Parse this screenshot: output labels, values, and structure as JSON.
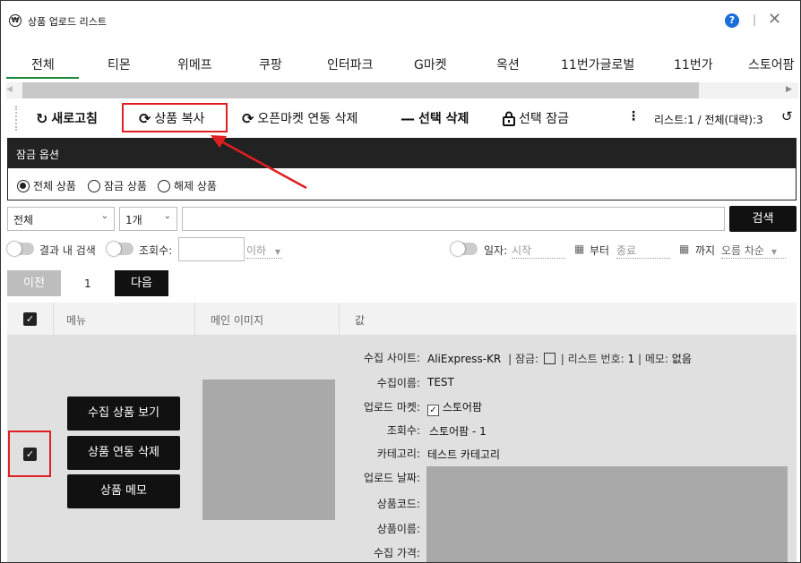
{
  "window": {
    "title": "상품 업로드 리스트",
    "app_icon": "coin-icon",
    "help": "?"
  },
  "tabs": [
    {
      "label": "전체",
      "active": true
    },
    {
      "label": "티몬"
    },
    {
      "label": "위메프"
    },
    {
      "label": "쿠팡"
    },
    {
      "label": "인터파크"
    },
    {
      "label": "G마켓"
    },
    {
      "label": "옥션"
    },
    {
      "label": "11번가글로벌"
    },
    {
      "label": "11번가"
    },
    {
      "label": "스토어팜"
    }
  ],
  "toolbar": {
    "refresh_label": "새로고침",
    "copy_label": "상품 복사",
    "openmarket_delete_label": "오픈마켓 연동 삭제",
    "selected_delete_label": "선택 삭제",
    "selected_lock_label": "선택 잠금",
    "list_count": "리스트:1  /  전체(대략):3"
  },
  "lock_options": {
    "title": "잠금 옵션",
    "options": [
      "전체 상품",
      "잠금 상품",
      "해제 상품"
    ],
    "selected": "전체 상품"
  },
  "filter": {
    "category_select": "전체",
    "count_select": "1개",
    "search_value": "",
    "search_button": "검색",
    "result_search_label": "결과 내 검색",
    "views_label": "조회수:",
    "views_suffix": "이하",
    "date_label": "일자:",
    "start_placeholder": "시작",
    "from_label": "부터",
    "end_placeholder": "종료",
    "until_label": "까지",
    "sort_label": "오름 차순"
  },
  "pagination": {
    "prev": "이전",
    "page": "1",
    "next": "다음"
  },
  "table": {
    "headers": [
      "메뉴",
      "메인 이미지",
      "값"
    ],
    "row": {
      "actions": [
        "수집 상품 보기",
        "상품 연동 삭제",
        "상품 메모"
      ],
      "collect_site_label": "수집 사이트:",
      "collect_site_value": "AliExpress-KR",
      "lock_label": "| 잠금:",
      "list_no_label": "| 리스트 번호:",
      "list_no_value": "1",
      "memo_label": "| 메모:",
      "memo_value": "없음",
      "collect_name_label": "수집이름:",
      "collect_name_value": "TEST",
      "upload_market_label": "업로드 마켓:",
      "upload_market_value": "스토어팜",
      "views_label": "조회수:",
      "views_value": "스토어팜  -  1",
      "category_label": "카테고리:",
      "category_value": "테스트 카테고리",
      "upload_date_label": "업로드 날짜:",
      "product_code_label": "상품코드:",
      "product_name_label": "상품이름:",
      "collect_price_label": "수집 가격:"
    }
  },
  "colors": {
    "accent": "#1a8c3c",
    "highlight": "#e02020",
    "dark": "#222222",
    "help": "#1a6ed8"
  }
}
